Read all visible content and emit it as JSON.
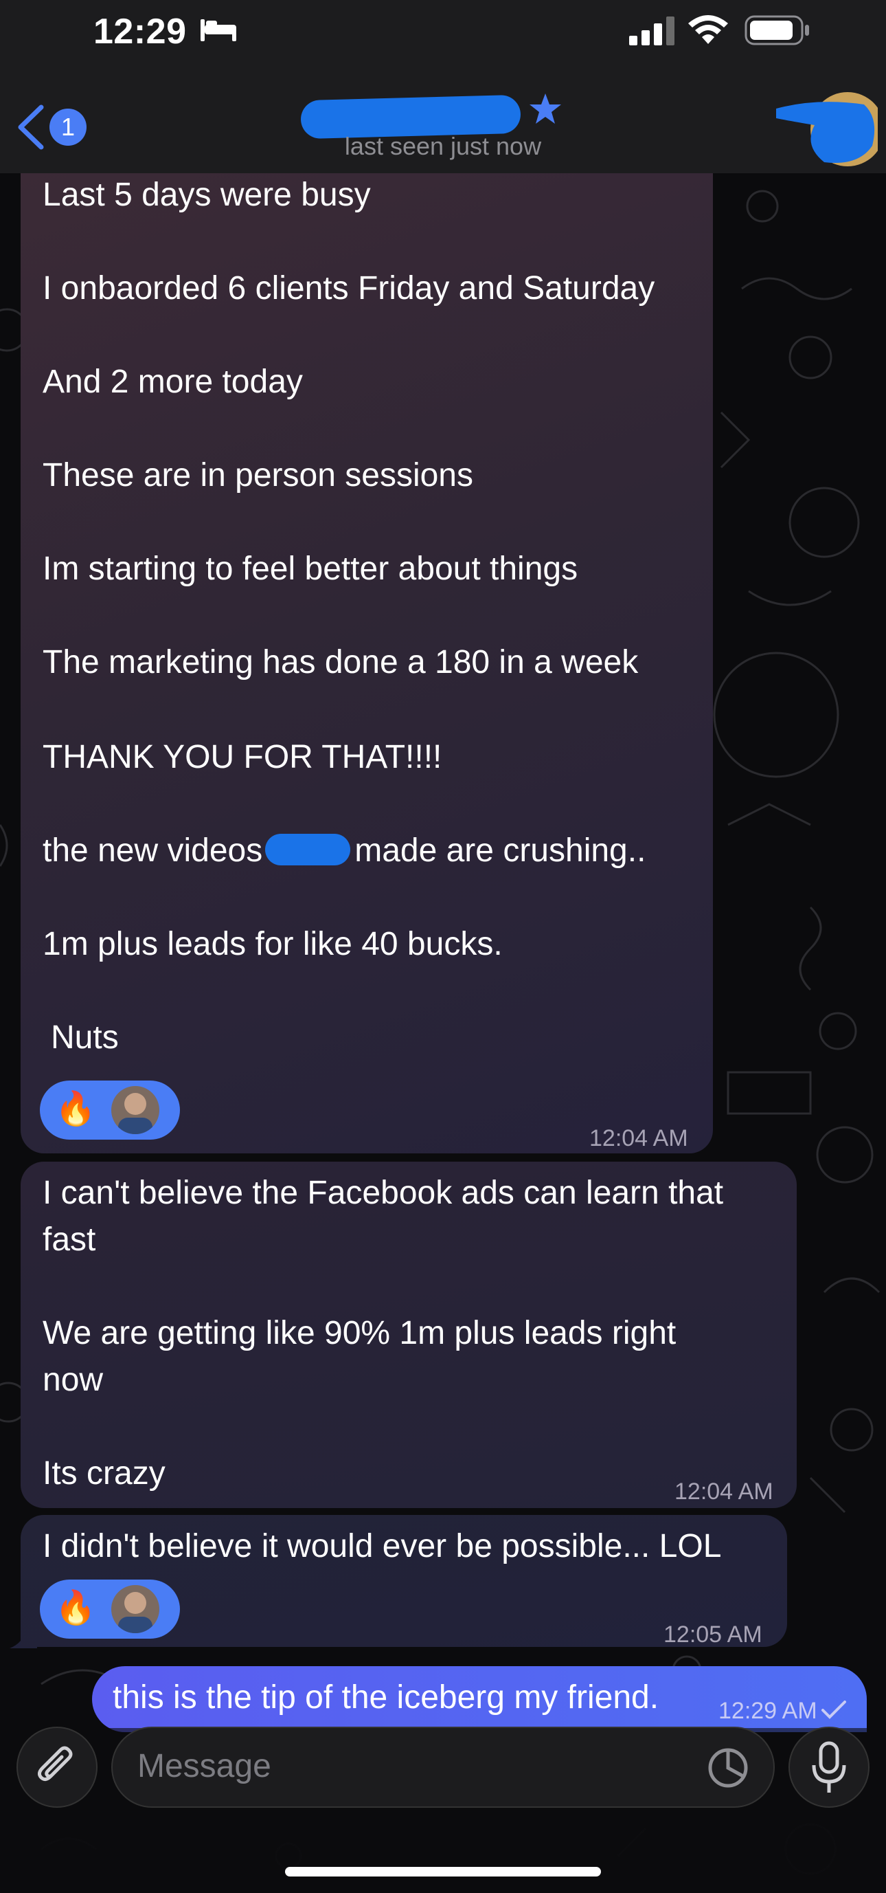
{
  "status_bar": {
    "time": "12:29",
    "icons": [
      "bed-icon",
      "signal-icon",
      "wifi-icon",
      "battery-icon"
    ]
  },
  "header": {
    "back_badge": "1",
    "subtitle": "last seen just now",
    "icons": [
      "chevron-left-icon",
      "star-icon"
    ]
  },
  "messages": [
    {
      "lines": [
        "Last 5 days were busy",
        "I onbaorded 6 clients Friday and Saturday",
        "And 2 more today",
        "These are in person sessions",
        "Im starting to feel better about things",
        "The marketing has done a 180 in a week",
        "THANK YOU FOR THAT!!!!",
        "the new videos",
        "made are crushing..",
        "1m plus leads for like 40 bucks.",
        "Nuts"
      ],
      "time": "12:04 AM",
      "reaction": "🔥"
    },
    {
      "lines": [
        "I can't believe the Facebook ads can learn that",
        "fast",
        "We are getting like 90% 1m plus leads right",
        "now",
        "Its crazy"
      ],
      "time": "12:04 AM"
    },
    {
      "lines": [
        "I didn't believe it would ever be possible... LOL"
      ],
      "time": "12:05 AM",
      "reaction": "🔥"
    },
    {
      "lines": [
        "this is the tip of the iceberg my friend."
      ],
      "time": "12:29 AM",
      "outgoing": true
    }
  ],
  "composer": {
    "placeholder": "Message",
    "icons": [
      "paperclip-icon",
      "sticker-icon",
      "microphone-icon"
    ]
  },
  "colors": {
    "accent": "#4a7df5",
    "outgoing_bubble": "#5a5df0",
    "header_bg": "#1c1c1e"
  }
}
